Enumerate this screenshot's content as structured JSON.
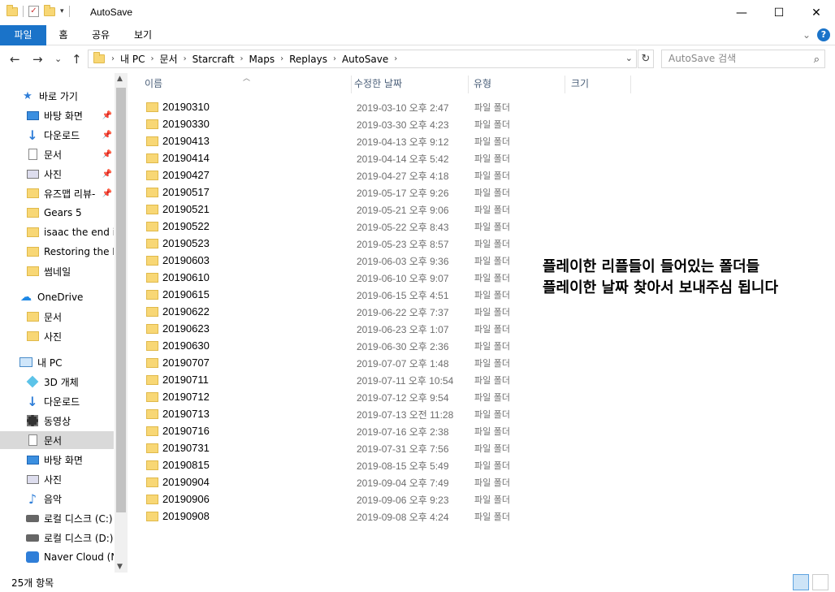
{
  "window": {
    "title": "AutoSave",
    "minimize": "—",
    "maximize": "☐",
    "close": "✕"
  },
  "ribbon": {
    "tabs": [
      "파일",
      "홈",
      "공유",
      "보기"
    ]
  },
  "nav": {
    "back": "←",
    "forward": "→",
    "recent": "⌄",
    "up": "↑"
  },
  "address": {
    "crumbs": [
      "내 PC",
      "문서",
      "Starcraft",
      "Maps",
      "Replays",
      "AutoSave"
    ]
  },
  "search": {
    "placeholder": "AutoSave 검색"
  },
  "sidebar": {
    "quick_access": "바로 가기",
    "quick_items": [
      "바탕 화면",
      "다운로드",
      "문서",
      "사진",
      "유즈맵 리뷰-",
      "Gears 5",
      "isaac the end is",
      "Restoring the Lig",
      "썸네일"
    ],
    "onedrive": "OneDrive",
    "onedrive_items": [
      "문서",
      "사진"
    ],
    "pc": "내 PC",
    "pc_items": [
      "3D 개체",
      "다운로드",
      "동영상",
      "문서",
      "바탕 화면",
      "사진",
      "음악",
      "로컬 디스크 (C:)",
      "로컬 디스크 (D:)",
      "Naver Cloud (N:"
    ]
  },
  "columns": {
    "name": "이름",
    "modified": "수정한 날짜",
    "type": "유형",
    "size": "크기"
  },
  "files": [
    {
      "name": "20190310",
      "date": "2019-03-10 오후 2:47",
      "type": "파일 폴더"
    },
    {
      "name": "20190330",
      "date": "2019-03-30 오후 4:23",
      "type": "파일 폴더"
    },
    {
      "name": "20190413",
      "date": "2019-04-13 오후 9:12",
      "type": "파일 폴더"
    },
    {
      "name": "20190414",
      "date": "2019-04-14 오후 5:42",
      "type": "파일 폴더"
    },
    {
      "name": "20190427",
      "date": "2019-04-27 오후 4:18",
      "type": "파일 폴더"
    },
    {
      "name": "20190517",
      "date": "2019-05-17 오후 9:26",
      "type": "파일 폴더"
    },
    {
      "name": "20190521",
      "date": "2019-05-21 오후 9:06",
      "type": "파일 폴더"
    },
    {
      "name": "20190522",
      "date": "2019-05-22 오후 8:43",
      "type": "파일 폴더"
    },
    {
      "name": "20190523",
      "date": "2019-05-23 오후 8:57",
      "type": "파일 폴더"
    },
    {
      "name": "20190603",
      "date": "2019-06-03 오후 9:36",
      "type": "파일 폴더"
    },
    {
      "name": "20190610",
      "date": "2019-06-10 오후 9:07",
      "type": "파일 폴더"
    },
    {
      "name": "20190615",
      "date": "2019-06-15 오후 4:51",
      "type": "파일 폴더"
    },
    {
      "name": "20190622",
      "date": "2019-06-22 오후 7:37",
      "type": "파일 폴더"
    },
    {
      "name": "20190623",
      "date": "2019-06-23 오후 1:07",
      "type": "파일 폴더"
    },
    {
      "name": "20190630",
      "date": "2019-06-30 오후 2:36",
      "type": "파일 폴더"
    },
    {
      "name": "20190707",
      "date": "2019-07-07 오후 1:48",
      "type": "파일 폴더"
    },
    {
      "name": "20190711",
      "date": "2019-07-11 오후 10:54",
      "type": "파일 폴더"
    },
    {
      "name": "20190712",
      "date": "2019-07-12 오후 9:54",
      "type": "파일 폴더"
    },
    {
      "name": "20190713",
      "date": "2019-07-13 오전 11:28",
      "type": "파일 폴더"
    },
    {
      "name": "20190716",
      "date": "2019-07-16 오후 2:38",
      "type": "파일 폴더"
    },
    {
      "name": "20190731",
      "date": "2019-07-31 오후 7:56",
      "type": "파일 폴더"
    },
    {
      "name": "20190815",
      "date": "2019-08-15 오후 5:49",
      "type": "파일 폴더"
    },
    {
      "name": "20190904",
      "date": "2019-09-04 오후 7:49",
      "type": "파일 폴더"
    },
    {
      "name": "20190906",
      "date": "2019-09-06 오후 9:23",
      "type": "파일 폴더"
    },
    {
      "name": "20190908",
      "date": "2019-09-08 오후 4:24",
      "type": "파일 폴더"
    }
  ],
  "annotation": {
    "line1": "플레이한 리플들이 들어있는 폴더들",
    "line2": "플레이한 날짜 찾아서 보내주심 됩니다"
  },
  "status": {
    "count": "25개 항목"
  },
  "colors": {
    "file_tab": "#1a73c9",
    "selected_nav": "#d9d9d9",
    "folder": "#f8d775"
  }
}
